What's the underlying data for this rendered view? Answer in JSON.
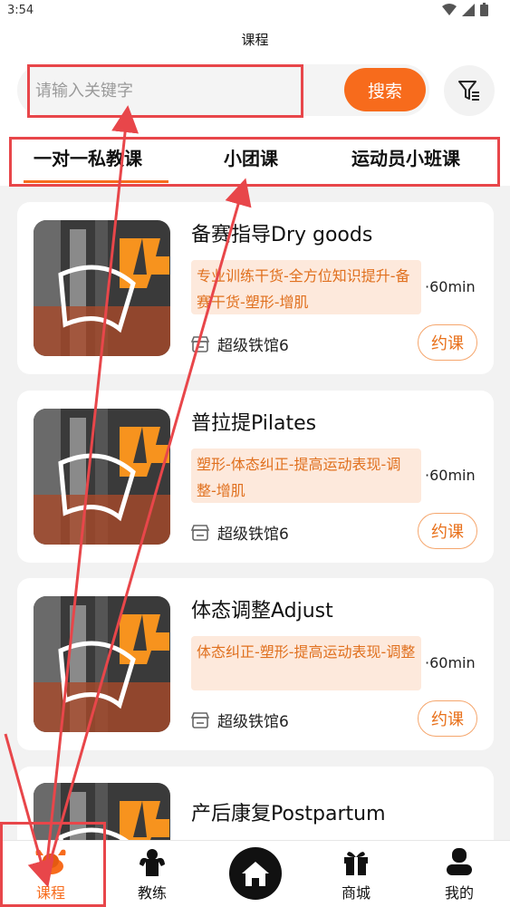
{
  "status_bar": {
    "time": "3:54"
  },
  "header": {
    "title": "课程"
  },
  "search": {
    "placeholder": "请输入关键字",
    "button_label": "搜索"
  },
  "tabs": [
    {
      "label": "一对一私教课",
      "active": true
    },
    {
      "label": "小团课",
      "active": false
    },
    {
      "label": "运动员小班课",
      "active": false
    }
  ],
  "courses": [
    {
      "title": "备赛指导Dry goods",
      "tags": "专业训练干货-全方位知识提升-备赛干货-塑形-增肌",
      "duration": "·60min",
      "gym": "超级铁馆6",
      "book_label": "约课"
    },
    {
      "title": "普拉提Pilates",
      "tags": "塑形-体态纠正-提高运动表现-调整-增肌",
      "duration": "·60min",
      "gym": "超级铁馆6",
      "book_label": "约课"
    },
    {
      "title": "体态调整Adjust",
      "tags": "体态纠正-塑形-提高运动表现-调整",
      "duration": "·60min",
      "gym": "超级铁馆6",
      "book_label": "约课"
    },
    {
      "title": "产后康复Postpartum"
    }
  ],
  "nav": [
    {
      "label": "课程",
      "icon": "course-icon",
      "active": true
    },
    {
      "label": "教练",
      "icon": "coach-icon",
      "active": false
    },
    {
      "label": "",
      "icon": "home-icon",
      "active": false
    },
    {
      "label": "商城",
      "icon": "gift-shop-icon",
      "active": false
    },
    {
      "label": "我的",
      "icon": "profile-icon",
      "active": false
    }
  ],
  "colors": {
    "accent": "#f76b1c",
    "tag_bg": "#fde9dc",
    "annotation": "#e8464a"
  }
}
